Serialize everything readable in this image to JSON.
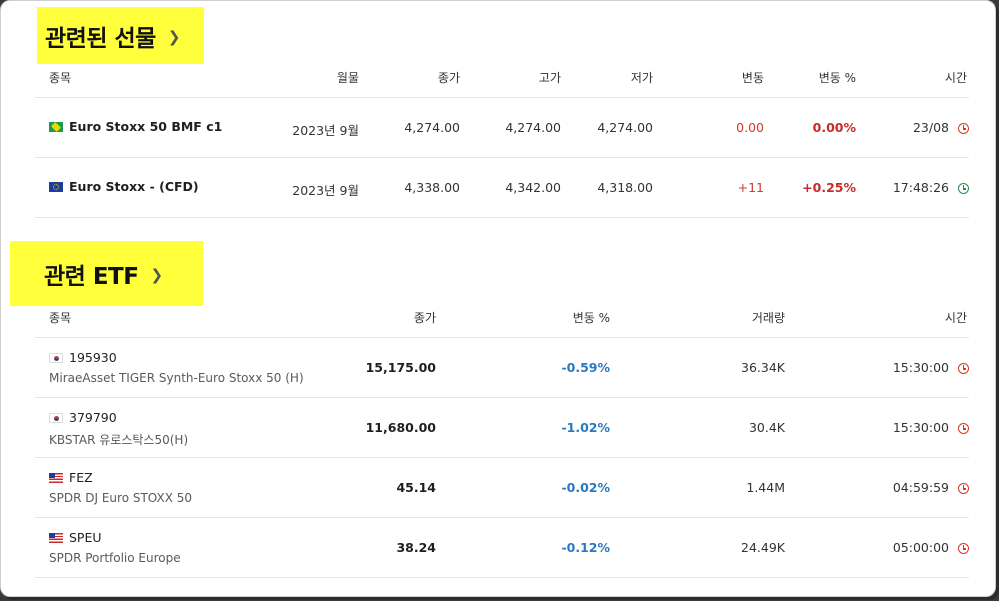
{
  "futures": {
    "title": "관련된 선물",
    "headers": [
      "종목",
      "월물",
      "종가",
      "고가",
      "저가",
      "변동",
      "변동 %",
      "시간"
    ],
    "rows": [
      {
        "flag": "brazil-flag",
        "name": "Euro Stoxx 50 BMF c1",
        "month": "2023년 9월",
        "close": "4,274.00",
        "high": "4,274.00",
        "low": "4,274.00",
        "change": "0.00",
        "change_pct": "0.00%",
        "time": "23/08",
        "clock": "red"
      },
      {
        "flag": "eu-flag",
        "name": "Euro Stoxx - (CFD)",
        "month": "2023년 9월",
        "close": "4,338.00",
        "high": "4,342.00",
        "low": "4,318.00",
        "change": "+11",
        "change_pct": "+0.25%",
        "time": "17:48:26",
        "clock": "green"
      }
    ]
  },
  "etf": {
    "title": "관련 ETF",
    "headers": [
      "종목",
      "종가",
      "변동 %",
      "거래량",
      "시간"
    ],
    "rows": [
      {
        "flag": "korea-flag",
        "symbol": "195930",
        "name": "MiraeAsset TIGER Synth-Euro Stoxx 50 (H)",
        "close": "15,175.00",
        "change_pct": "-0.59%",
        "volume": "36.34K",
        "time": "15:30:00"
      },
      {
        "flag": "korea-flag",
        "symbol": "379790",
        "name": "KBSTAR 유로스탁스50(H)",
        "close": "11,680.00",
        "change_pct": "-1.02%",
        "volume": "30.4K",
        "time": "15:30:00"
      },
      {
        "flag": "us-flag",
        "symbol": "FEZ",
        "name": "SPDR DJ Euro STOXX 50",
        "close": "45.14",
        "change_pct": "-0.02%",
        "volume": "1.44M",
        "time": "04:59:59"
      },
      {
        "flag": "us-flag",
        "symbol": "SPEU",
        "name": "SPDR Portfolio Europe",
        "close": "38.24",
        "change_pct": "-0.12%",
        "volume": "24.49K",
        "time": "05:00:00"
      }
    ]
  },
  "colors": {
    "highlight": "#ffff3b",
    "negative": "#c92a2a",
    "etf_change": "#2a78c2",
    "live": "#2e8b57"
  }
}
